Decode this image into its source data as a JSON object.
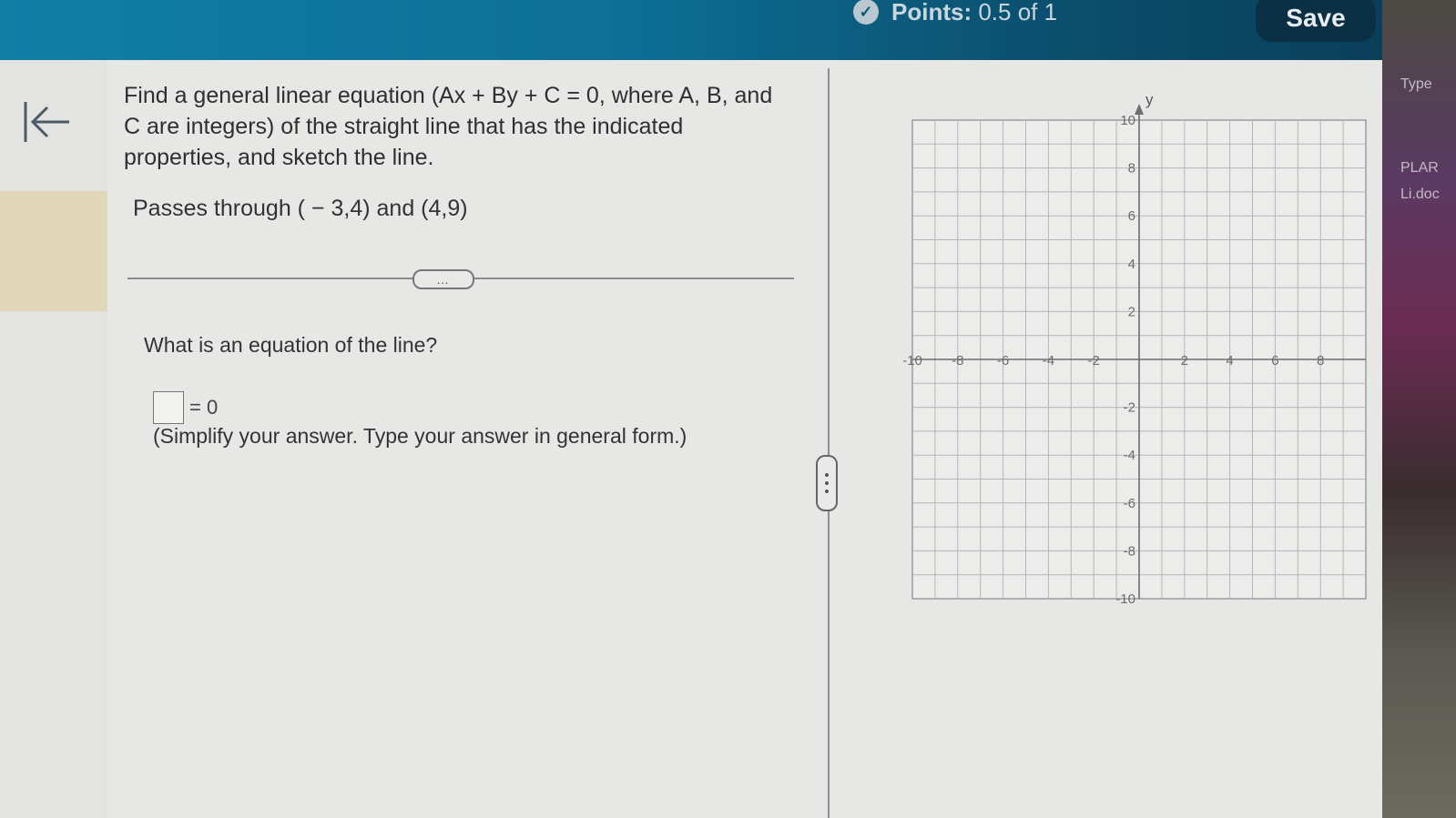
{
  "header": {
    "points_label": "Points:",
    "points_value": "0.5 of 1",
    "save_label": "Save",
    "points_icon": "partial-credit-icon"
  },
  "side_panel": {
    "items": [
      "Type",
      "PLAR",
      "Li.doc"
    ]
  },
  "question": {
    "text": "Find a general linear equation (Ax + By + C = 0, where A, B, and C are integers) of the straight line that has the indicated properties, and sketch the line.",
    "passes": "Passes through ( − 3,4) and (4,9)",
    "more_label": "…",
    "prompt": "What is an equation of the line?",
    "equals": "= 0",
    "answer_value": "",
    "hint": "(Simplify your answer. Type your answer in general form.)"
  },
  "graph": {
    "axis_y_label": "y",
    "x_min": -10,
    "x_max": 10,
    "y_min": -10,
    "y_max": 10,
    "x_tick_labels": [
      "-10",
      "-8",
      "-6",
      "-4",
      "-2",
      "2",
      "4",
      "6",
      "8"
    ],
    "y_tick_labels": [
      "10",
      "8",
      "6",
      "4",
      "2",
      "-2",
      "-4",
      "-6",
      "-8",
      "-10"
    ],
    "grid": true
  },
  "colors": {
    "header_bg": "#0d6f95",
    "save_bg": "#0b2f44",
    "page_bg": "#e7e8e6"
  }
}
